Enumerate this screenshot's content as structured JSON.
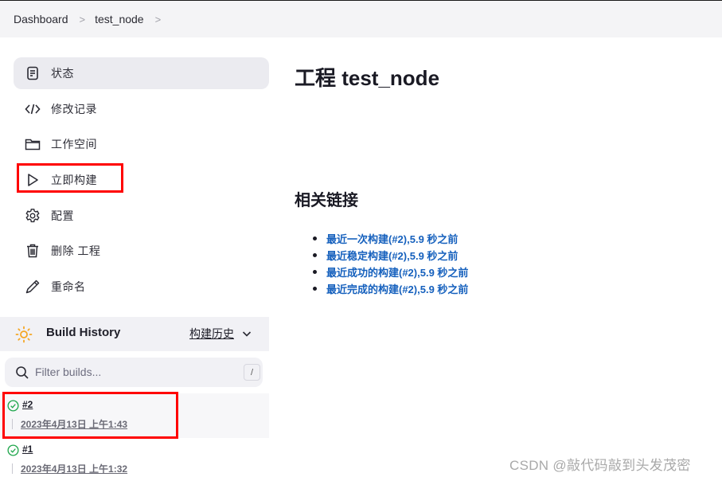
{
  "breadcrumb": {
    "items": [
      "Dashboard",
      "test_node"
    ],
    "separator": ">"
  },
  "sidebar": {
    "items": [
      {
        "label": "状态",
        "icon": "document-icon",
        "active": true
      },
      {
        "label": "修改记录",
        "icon": "code-icon"
      },
      {
        "label": "工作空间",
        "icon": "folder-icon"
      },
      {
        "label": "立即构建",
        "icon": "play-icon"
      },
      {
        "label": "配置",
        "icon": "gear-icon"
      },
      {
        "label": "删除 工程",
        "icon": "trash-icon"
      },
      {
        "label": "重命名",
        "icon": "pencil-icon"
      }
    ]
  },
  "build_history": {
    "title": "Build History",
    "link_label": "构建历史",
    "filter_placeholder": "Filter builds...",
    "filter_shortcut": "/",
    "builds": [
      {
        "number": "#2",
        "date": "2023年4月13日 上午1:43",
        "status": "success"
      },
      {
        "number": "#1",
        "date": "2023年4月13日 上午1:32",
        "status": "success"
      }
    ]
  },
  "main": {
    "title": "工程 test_node",
    "related_links_title": "相关链接",
    "links": [
      "最近一次构建(#2),5.9 秒之前",
      "最近稳定构建(#2),5.9 秒之前",
      "最近成功的构建(#2),5.9 秒之前",
      "最近完成的构建(#2),5.9 秒之前"
    ]
  },
  "watermark": "CSDN @敲代码敲到头发茂密",
  "colors": {
    "link": "#1560bd",
    "success": "#1ea64b",
    "sun": "#f5a623",
    "highlight_box": "#ff0000"
  }
}
